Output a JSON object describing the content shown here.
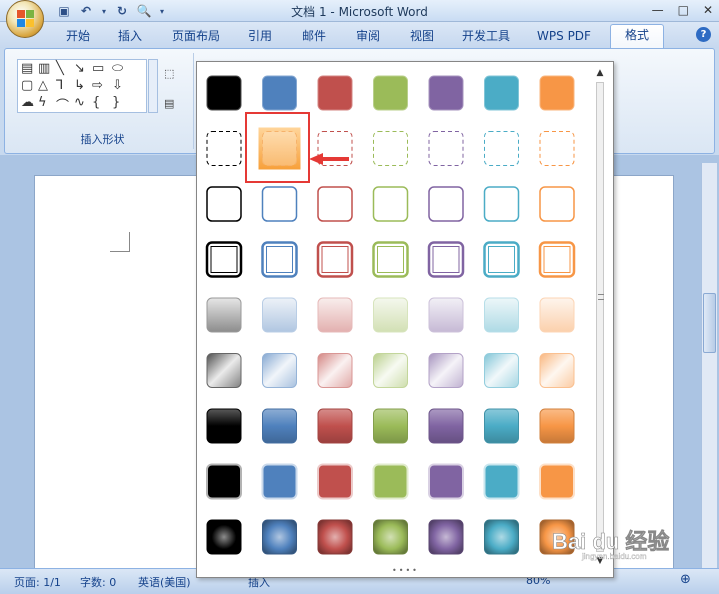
{
  "window": {
    "title": "文档 1 - Microsoft Word"
  },
  "ribbon": {
    "tabs": [
      "开始",
      "插入",
      "页面布局",
      "引用",
      "邮件",
      "审阅",
      "视图",
      "开发工具",
      "WPS PDF",
      "格式"
    ],
    "active_tab": "格式",
    "group_label": "插入形状"
  },
  "status": {
    "page": "页面: 1/1",
    "words": "字数: 0",
    "language": "英语(美国)",
    "insert": "插入",
    "zoom": "80%"
  },
  "gallery": {
    "column_colors": [
      "#000000",
      "#4f81bd",
      "#c0504d",
      "#9bbb59",
      "#8064a2",
      "#4bacc6",
      "#f79646"
    ],
    "row_styles": [
      "solid-fill",
      "dashed-outline",
      "thin-outline",
      "double-outline",
      "soft-gradient",
      "diagonal-gradient",
      "glossy",
      "white-border-fill",
      "radial-glow"
    ],
    "selected_cell": {
      "row": 1,
      "col": 1,
      "color": "#f79646"
    }
  },
  "watermark": {
    "text": "Bai du 经验",
    "subtext": "jingyan.baidu.com"
  }
}
